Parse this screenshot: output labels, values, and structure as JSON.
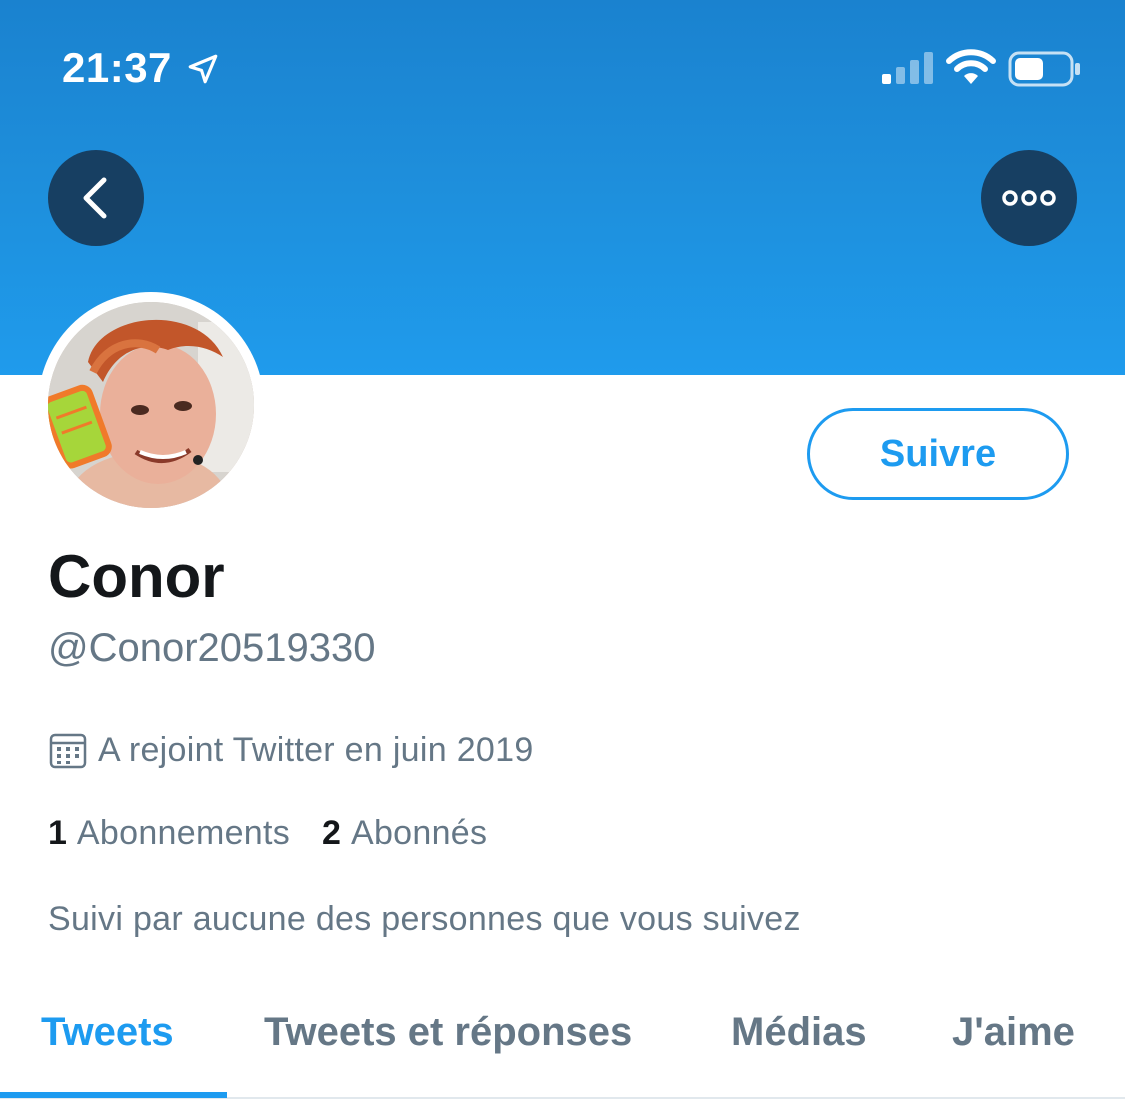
{
  "status_bar": {
    "time": "21:37",
    "icons": [
      "location-arrow-icon",
      "signal-icon",
      "wifi-icon",
      "battery-icon"
    ]
  },
  "header": {
    "back_icon": "chevron-left-icon",
    "more_icon": "ellipsis-icon",
    "banner_color": "#1e8fdc"
  },
  "profile": {
    "avatar": "profile-photo",
    "follow_label": "Suivre",
    "display_name": "Conor",
    "handle": "@Conor20519330",
    "joined": "A rejoint Twitter en juin 2019",
    "following_count": "1",
    "following_label": "Abonnements",
    "followers_count": "2",
    "followers_label": "Abonnés",
    "followed_by": "Suivi par aucune des personnes que vous suivez"
  },
  "tabs": [
    {
      "label": "Tweets",
      "active": true
    },
    {
      "label": "Tweets et réponses",
      "active": false
    },
    {
      "label": "Médias",
      "active": false
    },
    {
      "label": "J'aime",
      "active": false
    }
  ],
  "colors": {
    "accent": "#1d9bf0",
    "text_primary": "#14171a",
    "text_secondary": "#657786",
    "button_dark": "#173f62"
  }
}
